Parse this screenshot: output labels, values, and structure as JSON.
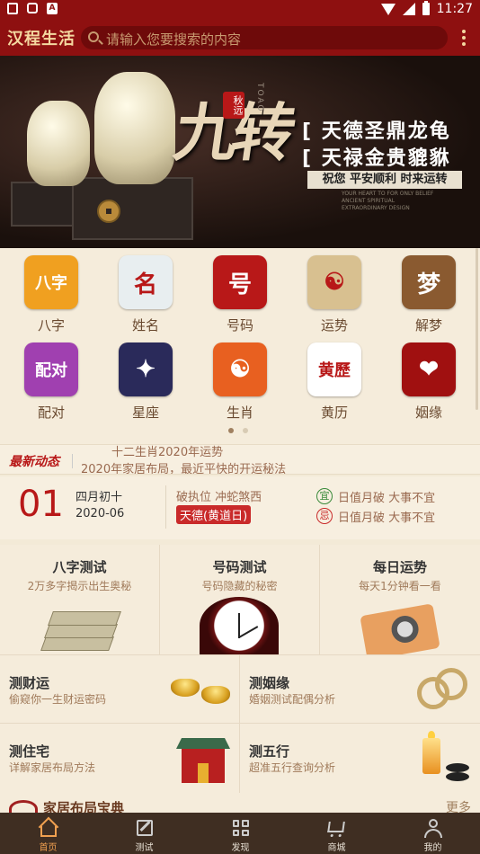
{
  "status_bar": {
    "time": "11:27"
  },
  "app": {
    "logo": "汉程生活",
    "search_placeholder": "请输入您要搜索的内容"
  },
  "banner": {
    "title": "九转",
    "seal": "秋远",
    "vertical_text": "TOAO",
    "line1": "[ 天德圣鼎龙龟",
    "line2": "[ 天禄金贵貔貅",
    "slogan": "祝您 平安顺利 时来运转",
    "fine_print": "YOUR HEART TO FOR ONLY BELIEF ANCIENT SPIRITUAL EXTRAORDINARY DESIGN"
  },
  "grid": [
    {
      "label": "八字",
      "icon_text": "八字",
      "icon": "bazi-icon",
      "color": "#f0a020"
    },
    {
      "label": "姓名",
      "icon_text": "名",
      "icon": "name-icon",
      "color": "#e8eef0"
    },
    {
      "label": "号码",
      "icon_text": "号",
      "icon": "number-icon",
      "color": "#b81818"
    },
    {
      "label": "运势",
      "icon_text": "☯",
      "icon": "fortune-icon",
      "color": "#d8c090"
    },
    {
      "label": "解梦",
      "icon_text": "梦",
      "icon": "dream-icon",
      "color": "#8a5a30"
    },
    {
      "label": "配对",
      "icon_text": "配对",
      "icon": "match-icon",
      "color": "#a040b0"
    },
    {
      "label": "星座",
      "icon_text": "✦",
      "icon": "zodiac-icon",
      "color": "#2a2a5a"
    },
    {
      "label": "生肖",
      "icon_text": "☯",
      "icon": "chinese-zodiac-icon",
      "color": "#e86020"
    },
    {
      "label": "黄历",
      "icon_text": "黄歷",
      "icon": "almanac-icon",
      "color": "#ffffff"
    },
    {
      "label": "姻缘",
      "icon_text": "❤",
      "icon": "marriage-icon",
      "color": "#a01010"
    }
  ],
  "news": {
    "tag": "最新动态",
    "headline": "2020年家居布局，最近平快的开运秘法",
    "prev_headline": "十二生肖2020年运势"
  },
  "calendar": {
    "day": "01",
    "lunar": "四月初十",
    "date": "2020-06",
    "zhi": "破执位 冲蛇煞西",
    "tag": "天德(黄道日)",
    "yi_label": "宜",
    "yi_text": "日值月破 大事不宜",
    "ji_label": "忌",
    "ji_text": "日值月破 大事不宜"
  },
  "tests": [
    {
      "title": "八字测试",
      "subtitle": "2万多字揭示出生奥秘"
    },
    {
      "title": "号码测试",
      "subtitle": "号码隐藏的秘密"
    },
    {
      "title": "每日运势",
      "subtitle": "每天1分钟看一看"
    }
  ],
  "rows": [
    {
      "title": "测财运",
      "subtitle": "偷窥你一生财运密码"
    },
    {
      "title": "测姻缘",
      "subtitle": "婚姻测试配偶分析"
    },
    {
      "title": "测住宅",
      "subtitle": "详解家居布局方法"
    },
    {
      "title": "测五行",
      "subtitle": "超准五行查询分析"
    }
  ],
  "section": {
    "title": "家居布局宝典",
    "more": "更多"
  },
  "tabs": [
    {
      "label": "首页"
    },
    {
      "label": "测试"
    },
    {
      "label": "发现"
    },
    {
      "label": "商城"
    },
    {
      "label": "我的"
    }
  ]
}
